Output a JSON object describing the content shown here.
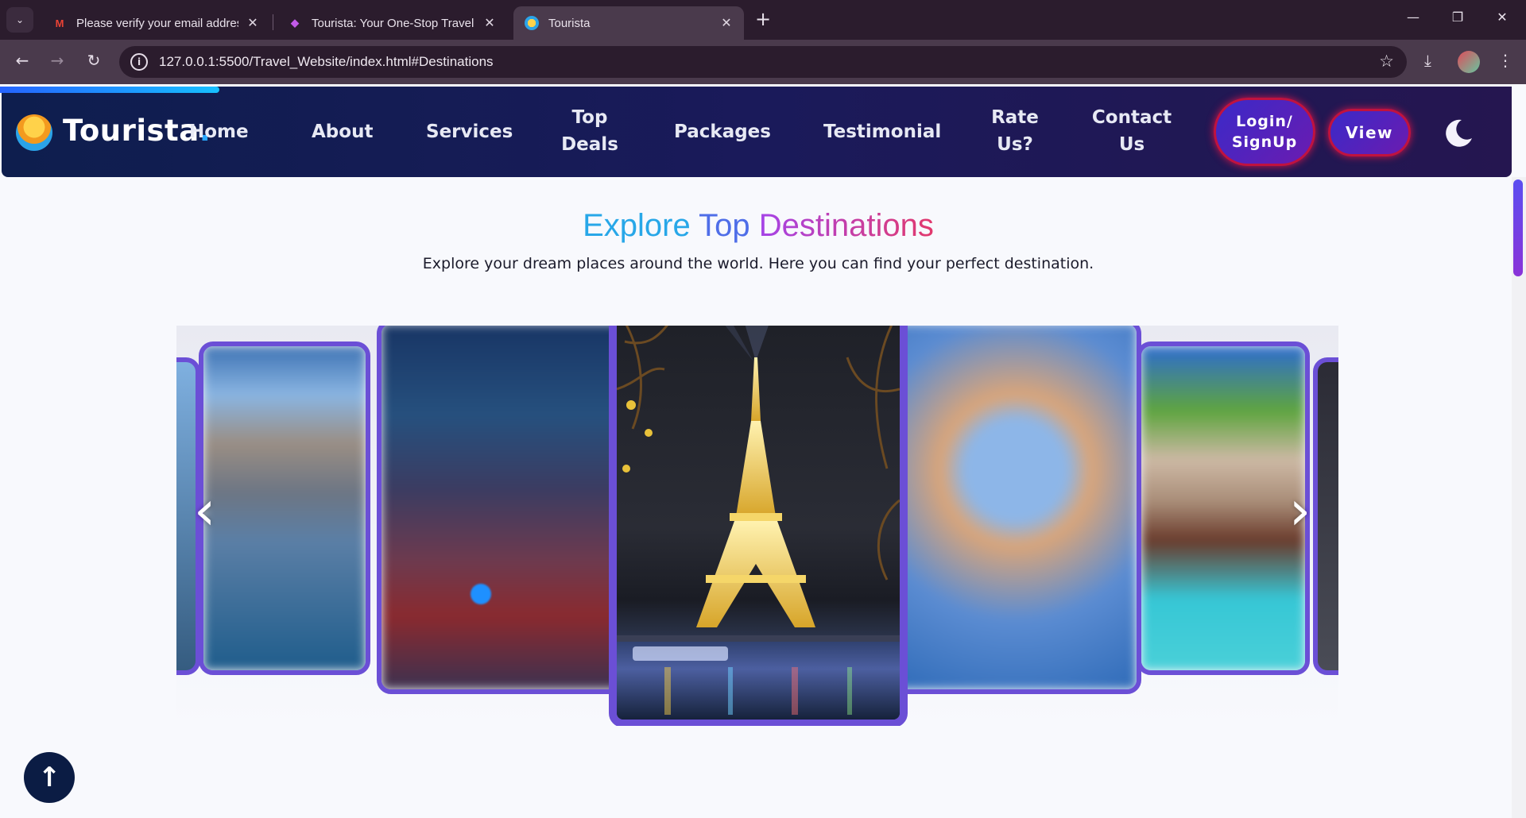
{
  "browser": {
    "tabs": [
      {
        "title": "Please verify your email address",
        "favicon": "gmail-icon",
        "active": false
      },
      {
        "title": "Tourista: Your One-Stop Travel Solution",
        "favicon": "tourista-icon",
        "active": false
      },
      {
        "title": "Tourista",
        "favicon": "tourista-icon",
        "active": true
      }
    ],
    "url": "127.0.0.1:5500/Travel_Website/index.html#Destinations"
  },
  "site": {
    "brand": "Tourista",
    "brand_dot": ".",
    "nav": [
      "Home",
      "About",
      "Services",
      "Top Deals",
      "Packages",
      "Testimonial",
      "Rate Us?",
      "Contact Us"
    ],
    "login_button": "Login/ SignUp",
    "view_button": "View",
    "section": {
      "title_part1": "Explore",
      "title_part2": "Top",
      "title_part3": "Destinations",
      "subtitle": "Explore your dream places around the world. Here you can find your perfect destination."
    },
    "carousel": {
      "prev": "‹",
      "next": "›",
      "slides": [
        "mountain-lake",
        "new-york-times-square",
        "eiffel-tower-night",
        "ferris-wheel",
        "overwater-bungalows"
      ],
      "active_index": 2
    },
    "scroll_top_icon": "↑"
  },
  "colors": {
    "nav_bg": "#1a1a5a",
    "accent_border": "#6b4fd6",
    "button_glow": "#d0164a"
  }
}
